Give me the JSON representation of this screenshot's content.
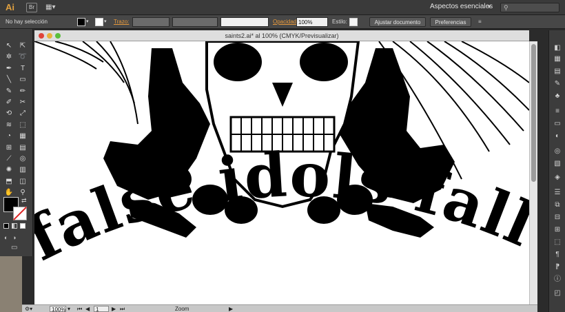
{
  "app": {
    "logo": "Ai",
    "bridge_label": "Br",
    "workspace": "Aspectos esenciales",
    "search_placeholder": ""
  },
  "controlbar": {
    "selection": "No hay selección",
    "stroke_label": "Trazo:",
    "opacity_label": "Opacidad:",
    "opacity_value": "100%",
    "style_label": "Estilo:",
    "adjust_doc": "Ajustar documento",
    "preferences": "Preferencias"
  },
  "document": {
    "tab_title": "saints2.ai* al 100% (CMYK/Previsualizar)",
    "artwork_text": "false idols fall"
  },
  "statusbar": {
    "zoom": "100%",
    "artboard": "1",
    "tool": "Zoom"
  },
  "colors": {
    "accent": "#e89a3c",
    "canvas": "#ffffff",
    "chrome": "#474747"
  }
}
